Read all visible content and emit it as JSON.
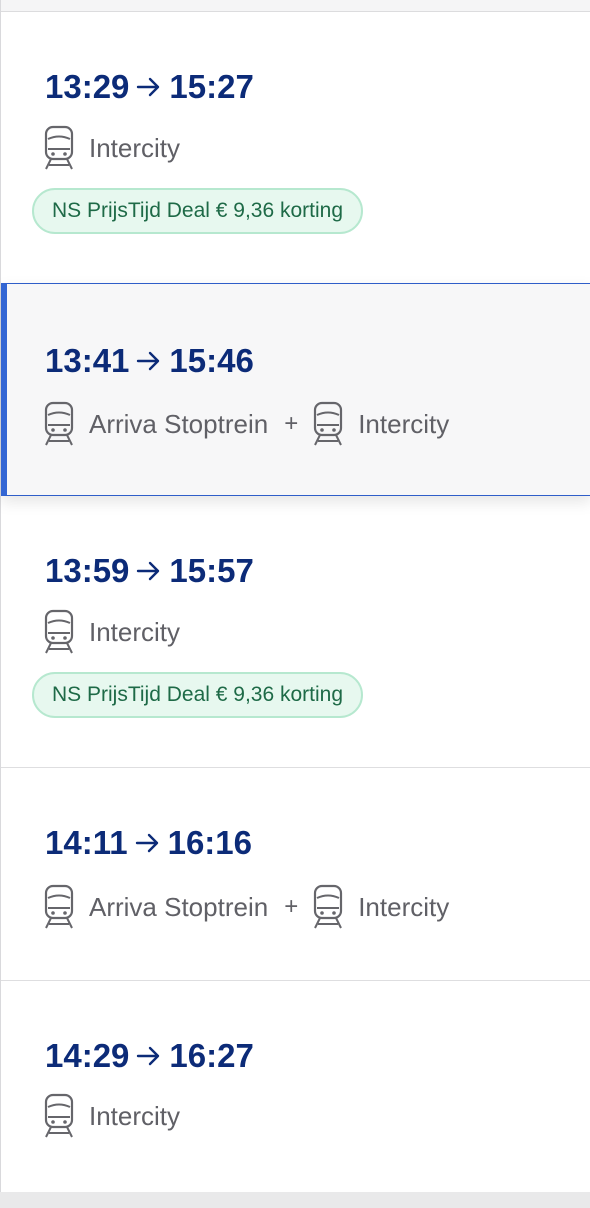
{
  "trips": [
    {
      "depart": "13:29",
      "arrive": "15:27",
      "legs": [
        {
          "icon": "train-icon",
          "label": "Intercity"
        }
      ],
      "badge": "NS PrijsTijd Deal € 9,36 korting"
    },
    {
      "depart": "13:41",
      "arrive": "15:46",
      "selected": true,
      "legs": [
        {
          "icon": "train-icon",
          "label": "Arriva Stoptrein"
        },
        {
          "icon": "train-icon",
          "label": "Intercity"
        }
      ],
      "connector": "+"
    },
    {
      "depart": "13:59",
      "arrive": "15:57",
      "legs": [
        {
          "icon": "train-icon",
          "label": "Intercity"
        }
      ],
      "badge": "NS PrijsTijd Deal € 9,36 korting"
    },
    {
      "depart": "14:11",
      "arrive": "16:16",
      "legs": [
        {
          "icon": "train-icon",
          "label": "Arriva Stoptrein"
        },
        {
          "icon": "train-icon",
          "label": "Intercity"
        }
      ],
      "connector": "+"
    },
    {
      "depart": "14:29",
      "arrive": "16:27",
      "legs": [
        {
          "icon": "train-icon",
          "label": "Intercity"
        }
      ]
    }
  ],
  "icons": {
    "arrow": "arrow-right-icon",
    "train": "train-icon"
  },
  "colors": {
    "time": "#0c2b78",
    "selected_border": "#3366d4",
    "badge_bg": "#e7f8ef",
    "badge_text": "#1e6a47"
  }
}
